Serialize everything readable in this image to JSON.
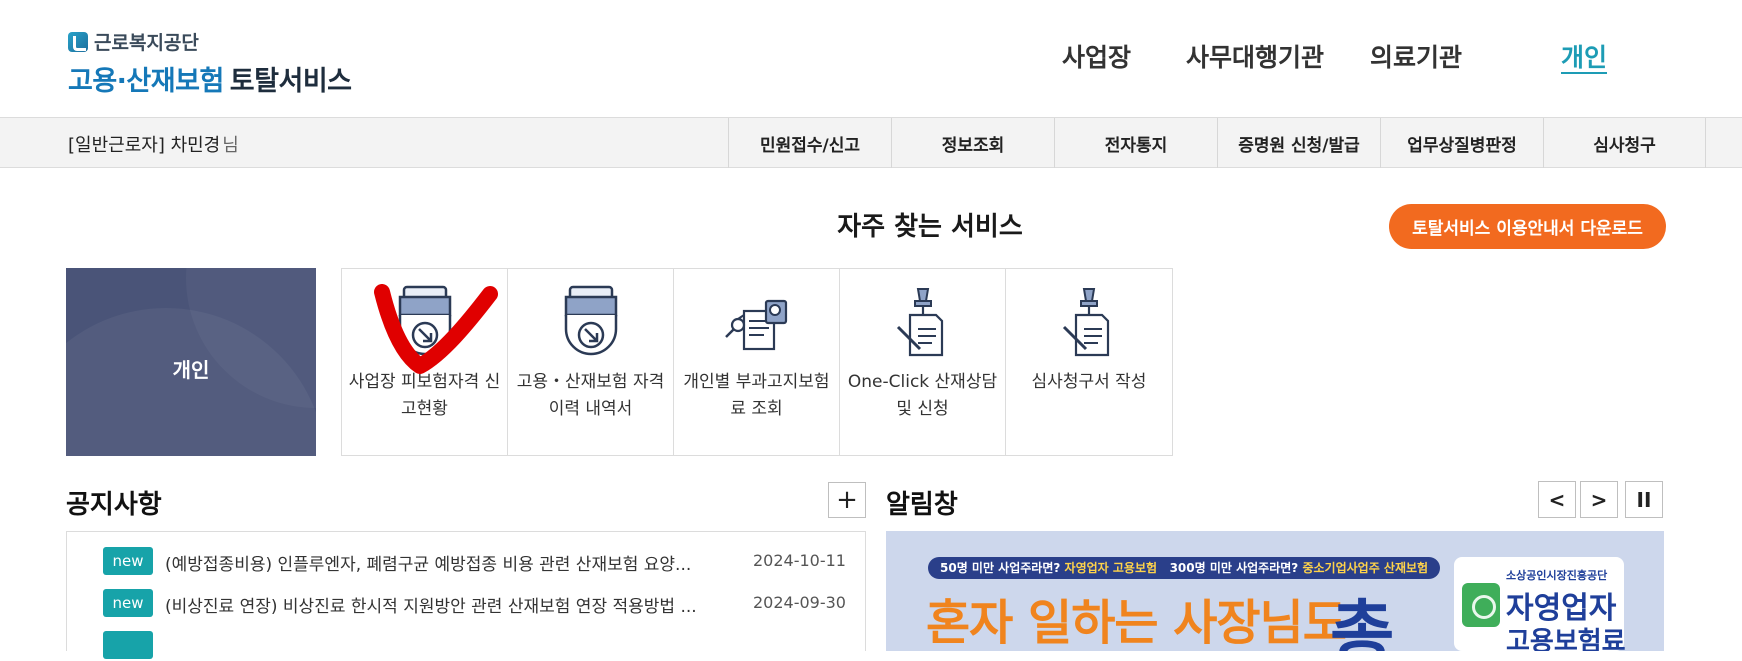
{
  "header": {
    "org_name": "근로복지공단",
    "service_title_a": "고용·산재보험",
    "service_title_b": "토탈서비스",
    "nav": [
      {
        "label": "사업장",
        "active": false
      },
      {
        "label": "사무대행기관",
        "active": false
      },
      {
        "label": "의료기관",
        "active": false
      },
      {
        "label": "개인",
        "active": true
      }
    ]
  },
  "subbar": {
    "user_label": "[일반근로자] 차민경",
    "user_suffix": "님",
    "menu": [
      "민원접수/신고",
      "정보조회",
      "전자통지",
      "증명원 신청/발급",
      "업무상질병판정",
      "심사청구"
    ]
  },
  "favorites": {
    "title": "자주 찾는 서비스",
    "download_button": "토탈서비스 이용안내서 다운로드",
    "persona_label": "개인",
    "items": [
      {
        "label": "사업장 피보험자격 신고현황",
        "icon": "download-monitor-icon"
      },
      {
        "label": "고용・산재보험 자격 이력 내역서",
        "icon": "download-monitor-icon"
      },
      {
        "label": "개인별 부과고지보험료 조회",
        "icon": "document-search-icon"
      },
      {
        "label": "One-Click 산재상담 및 신청",
        "icon": "pin-document-icon"
      },
      {
        "label": "심사청구서 작성",
        "icon": "pin-document-icon"
      }
    ]
  },
  "notices": {
    "title": "공지사항",
    "more_button": "+",
    "items": [
      {
        "badge": "new",
        "title": "(예방접종비용) 인플루엔자, 폐렴구균 예방접종 비용 관련 산재보험 요양...",
        "date": "2024-10-11"
      },
      {
        "badge": "new",
        "title": "(비상진료 연장) 비상진료 한시적 지원방안 관련 산재보험 연장 적용방법 ...",
        "date": "2024-09-30"
      }
    ]
  },
  "alerts": {
    "title": "알림창",
    "prev_button": "<",
    "next_button": ">",
    "pause_button": "II",
    "banner": {
      "strip_prefix": "50명 미만 사업주라면?",
      "strip_highlight1": "자영업자 고용보험",
      "strip_mid": "300명 미만 사업주라면?",
      "strip_highlight2": "중소기업사업주 산재보험",
      "headline": "혼자 일하는 사장님도",
      "big_char": "총",
      "card_org": "소상공인시장진흥공단",
      "card_line1": "자영업자",
      "card_line2": "고용보험료"
    }
  },
  "colors": {
    "accent": "#1d9cb5",
    "orange": "#f26a1f",
    "persona_bg": "#4a5478",
    "badge": "#17a3a9"
  }
}
